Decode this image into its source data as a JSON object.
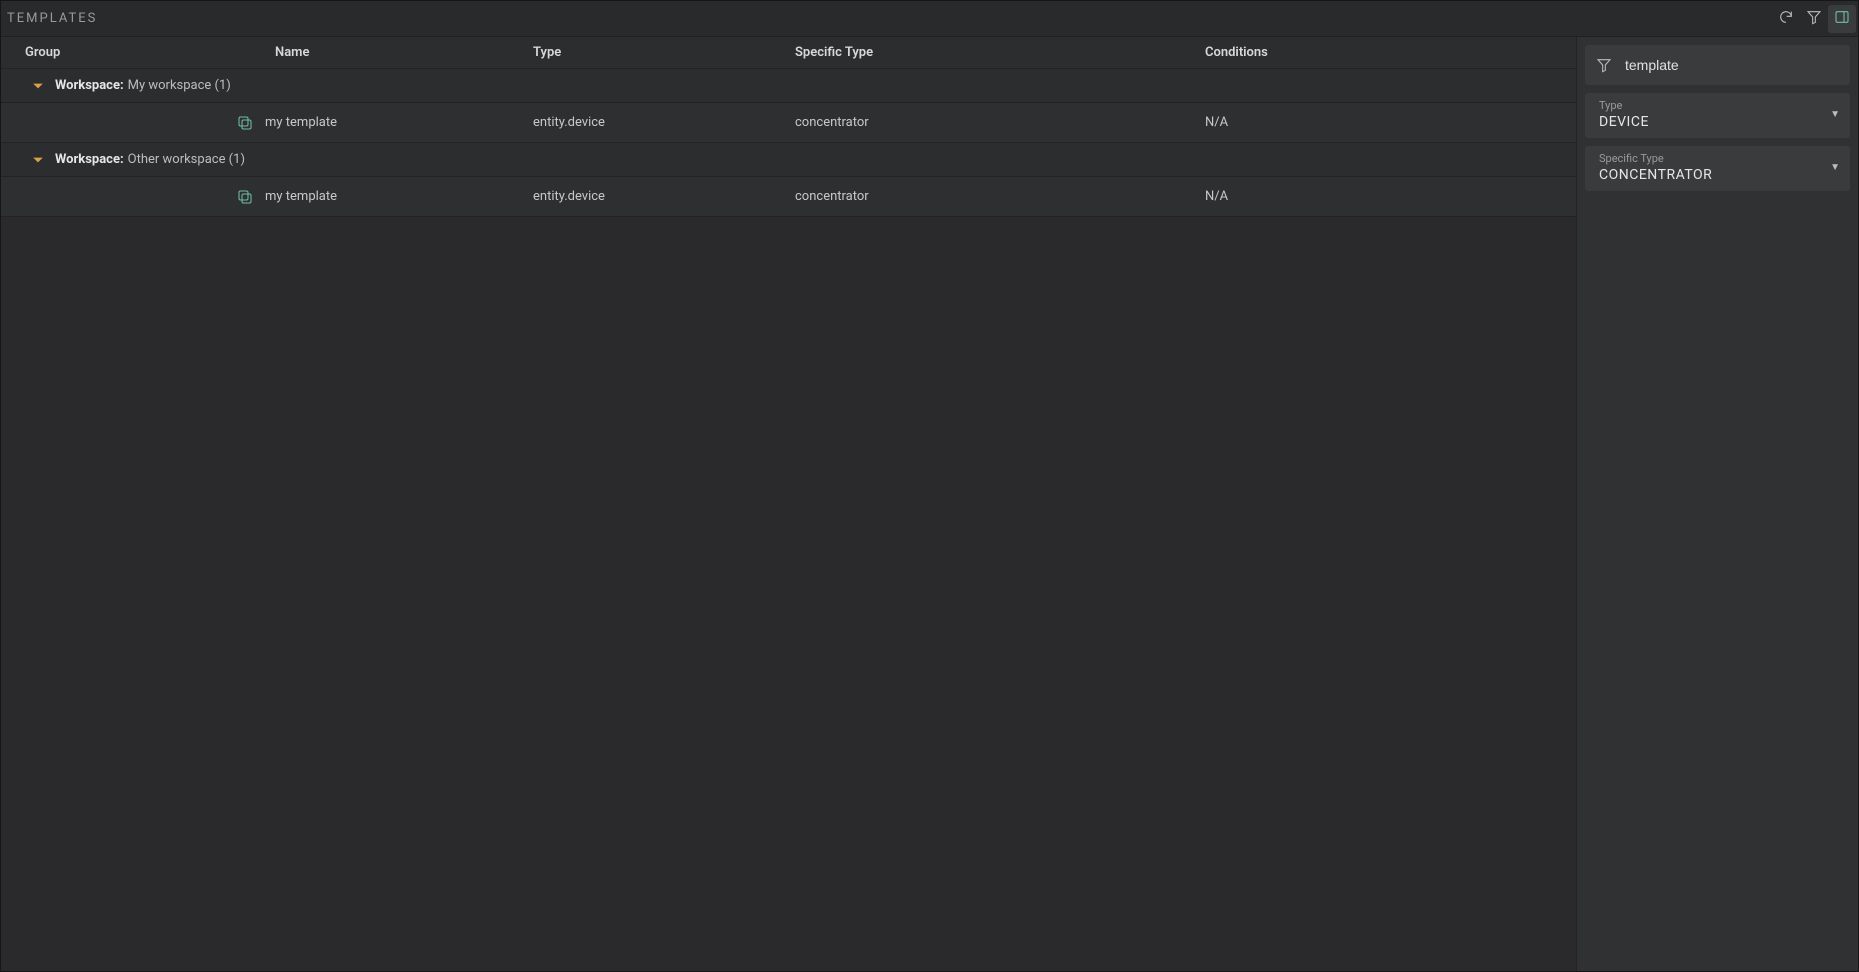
{
  "header": {
    "title": "TEMPLATES"
  },
  "columns": {
    "group": "Group",
    "name": "Name",
    "type": "Type",
    "specific_type": "Specific Type",
    "conditions": "Conditions"
  },
  "groups": [
    {
      "label_prefix": "Workspace:",
      "label_name": "My workspace (1)",
      "items": [
        {
          "name": "my template",
          "type": "entity.device",
          "specific_type": "concentrator",
          "conditions": "N/A"
        }
      ]
    },
    {
      "label_prefix": "Workspace:",
      "label_name": "Other workspace (1)",
      "items": [
        {
          "name": "my template",
          "type": "entity.device",
          "specific_type": "concentrator",
          "conditions": "N/A"
        }
      ]
    }
  ],
  "filter": {
    "search_value": "template",
    "type_label": "Type",
    "type_value": "DEVICE",
    "specific_type_label": "Specific Type",
    "specific_type_value": "CONCENTRATOR"
  }
}
